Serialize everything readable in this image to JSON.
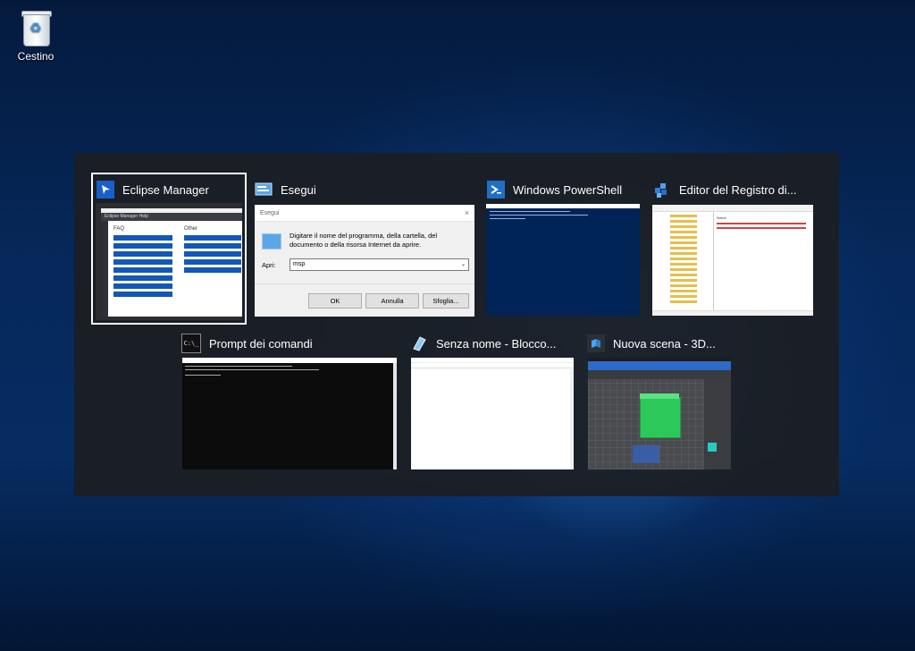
{
  "desktop": {
    "recycle_bin_label": "Cestino"
  },
  "switcher": {
    "windows": [
      {
        "title": "Eclipse Manager",
        "icon": "eclipse-manager-icon",
        "selected": true,
        "content": {
          "app_title": "Eclipse Manager Help",
          "faq_heading": "FAQ",
          "other_heading": "Other"
        }
      },
      {
        "title": "Esegui",
        "icon": "run-icon",
        "selected": false,
        "content": {
          "dialog_title": "Esegui",
          "description": "Digitare il nome del programma, della cartella, del documento o della risorsa Internet da aprire.",
          "open_label": "Apri:",
          "open_value": "msp",
          "ok": "OK",
          "cancel": "Annulla",
          "browse": "Sfoglia..."
        }
      },
      {
        "title": "Windows PowerShell",
        "icon": "powershell-icon",
        "selected": false
      },
      {
        "title": "Editor del Registro di...",
        "icon": "registry-editor-icon",
        "selected": false
      },
      {
        "title": "Prompt dei comandi",
        "icon": "command-prompt-icon",
        "selected": false
      },
      {
        "title": "Senza nome - Blocco...",
        "icon": "notepad-icon",
        "selected": false
      },
      {
        "title": "Nuova scena - 3D...",
        "icon": "paint-3d-icon",
        "selected": false
      }
    ]
  },
  "colors": {
    "selection_border": "#ffffff",
    "powershell_bg": "#012456",
    "accent_blue": "#0050c8"
  }
}
